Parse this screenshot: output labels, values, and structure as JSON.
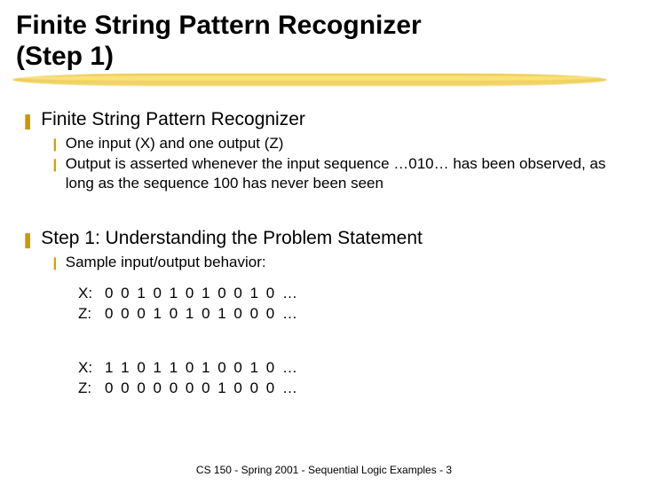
{
  "title_line1": "Finite String Pattern Recognizer",
  "title_line2": "(Step 1)",
  "section1": {
    "heading": "Finite String Pattern Recognizer",
    "b1": "One input (X) and one output (Z)",
    "b2": "Output is asserted whenever the input sequence …010… has been observed, as long as the sequence 100 has never been seen"
  },
  "section2": {
    "heading": "Step 1: Understanding the Problem Statement",
    "b1": "Sample input/output behavior:",
    "ex1": {
      "xlabel": "X:",
      "zlabel": "Z:",
      "x": "0 0 1 0 1 0 1 0 0 1 0 …",
      "z": "0 0 0 1 0 1 0 1 0 0 0 …"
    },
    "ex2": {
      "xlabel": "X:",
      "zlabel": "Z:",
      "x": "1 1 0 1 1 0 1 0 0 1 0 …",
      "z": "0 0 0 0 0 0 0 1 0 0 0 …"
    }
  },
  "footer": "CS 150 - Spring 2001 - Sequential Logic Examples - 3",
  "bullets": {
    "l1": "❚",
    "l2": "❙"
  }
}
